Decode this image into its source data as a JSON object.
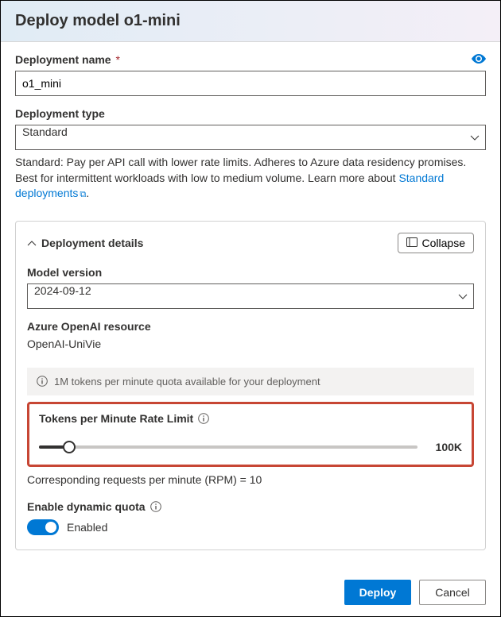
{
  "header": {
    "title": "Deploy model o1-mini"
  },
  "deployment_name": {
    "label": "Deployment name",
    "value": "o1_mini"
  },
  "deployment_type": {
    "label": "Deployment type",
    "selected": "Standard",
    "help_text_1": "Standard: Pay per API call with lower rate limits. Adheres to Azure data residency promises. Best for intermittent workloads with low to medium volume. Learn more about ",
    "link_text": "Standard deployments"
  },
  "details": {
    "title": "Deployment details",
    "collapse_label": "Collapse",
    "model_version": {
      "label": "Model version",
      "selected": "2024-09-12"
    },
    "resource": {
      "label": "Azure OpenAI resource",
      "value": "OpenAI-UniVie"
    },
    "quota_banner": "1M tokens per minute quota available for your deployment",
    "rate_limit": {
      "label": "Tokens per Minute Rate Limit",
      "value_display": "100K"
    },
    "rpm_text": "Corresponding requests per minute (RPM) = 10",
    "dynamic_quota": {
      "label": "Enable dynamic quota",
      "status": "Enabled"
    }
  },
  "footer": {
    "deploy": "Deploy",
    "cancel": "Cancel"
  }
}
